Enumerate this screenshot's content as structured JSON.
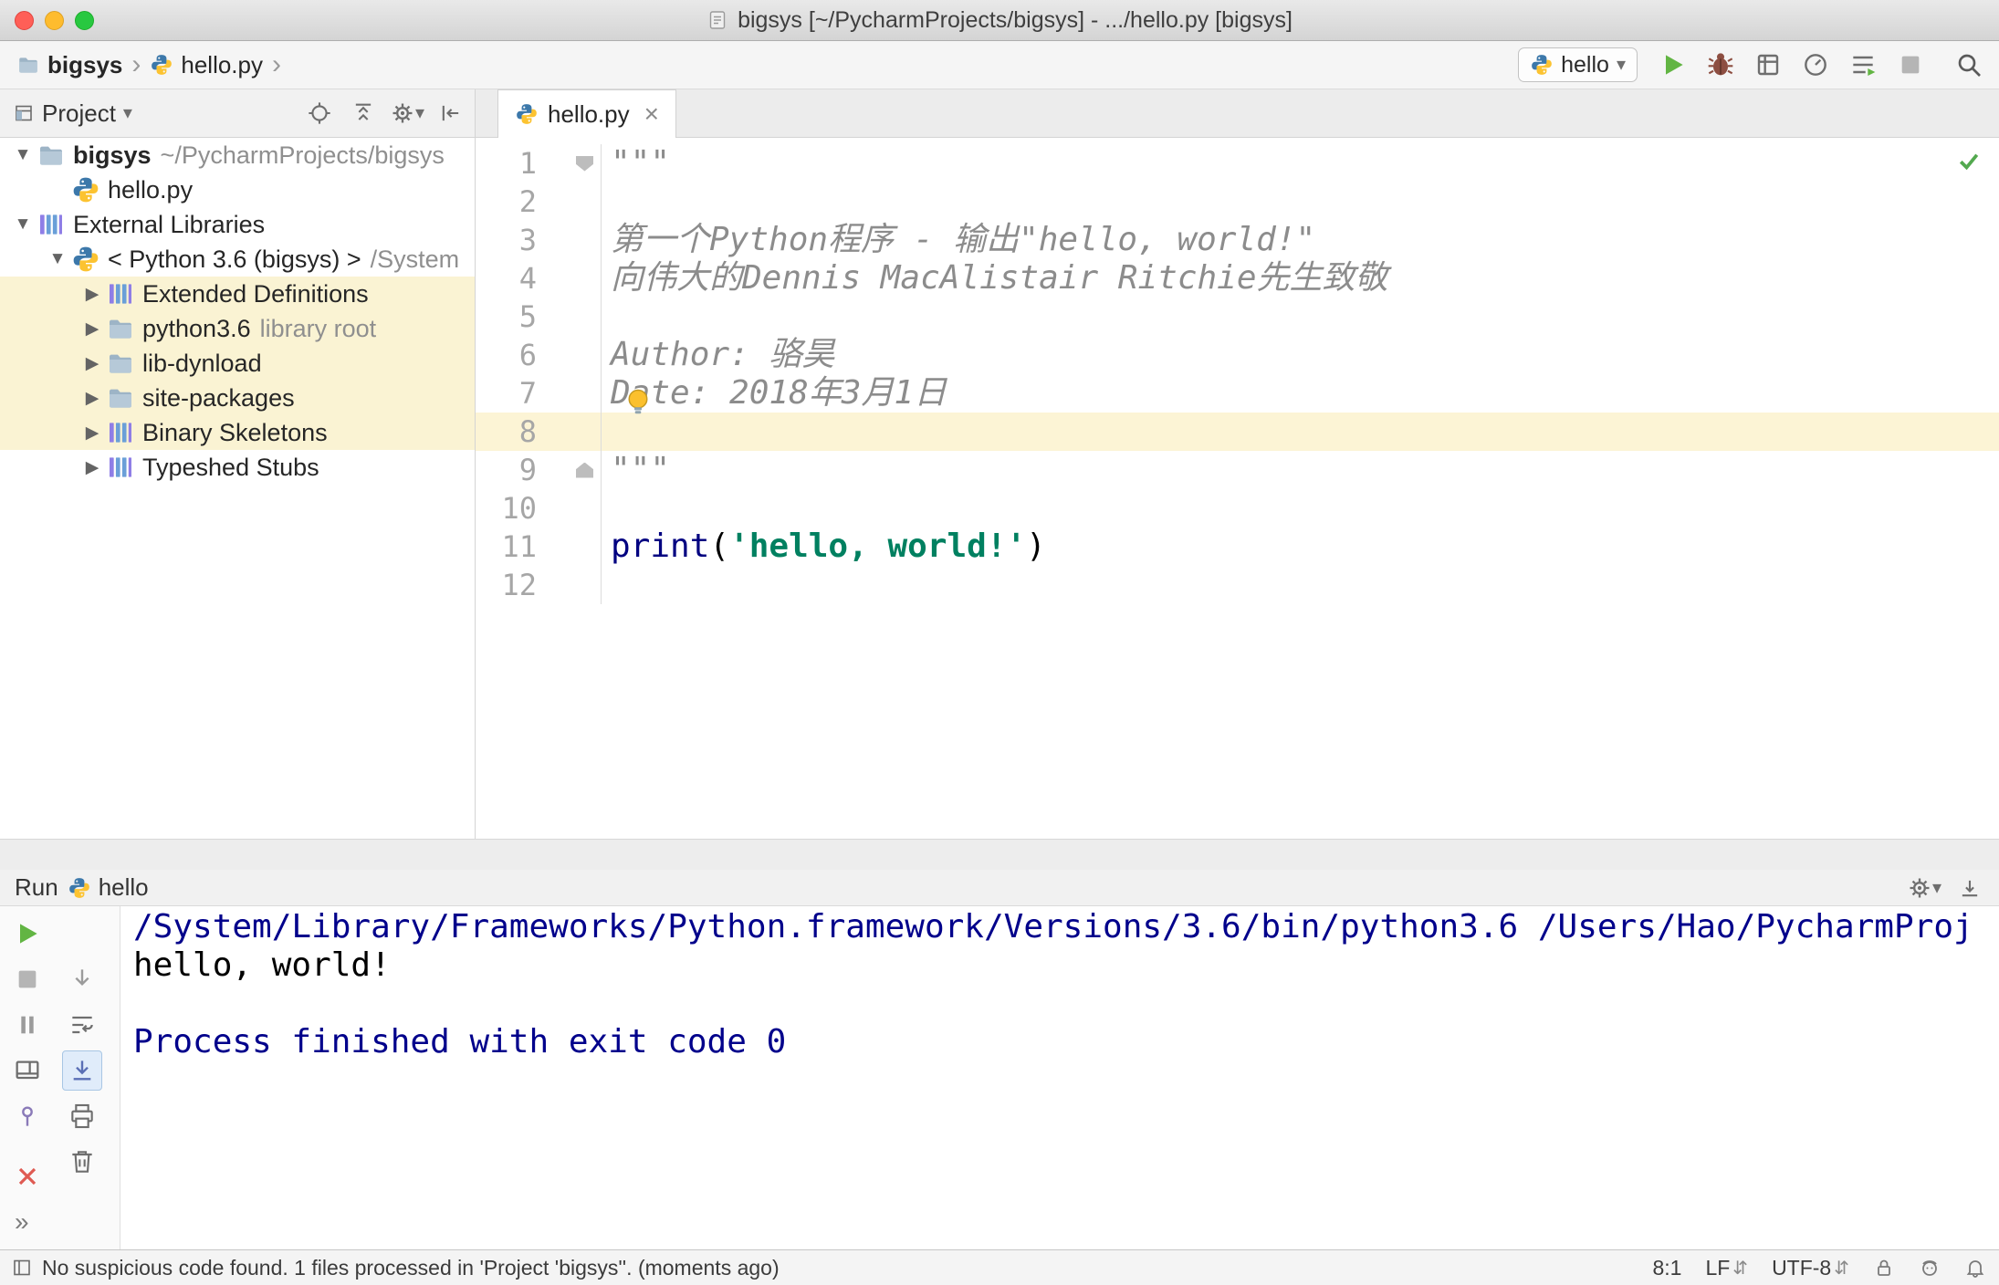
{
  "window": {
    "title": "bigsys [~/PycharmProjects/bigsys] - .../hello.py [bigsys]"
  },
  "navbar": {
    "breadcrumbs": [
      {
        "label": "bigsys",
        "icon": "folder"
      },
      {
        "label": "hello.py",
        "icon": "python"
      }
    ],
    "run_config": {
      "label": "hello"
    }
  },
  "project": {
    "header": {
      "title": "Project"
    },
    "tree": [
      {
        "level": 0,
        "chevron": "expanded",
        "icon": "folder",
        "label": "bigsys",
        "suffix": "~/PycharmProjects/bigsys",
        "bold": true
      },
      {
        "level": 1,
        "chevron": "none",
        "icon": "python",
        "label": "hello.py"
      },
      {
        "level": 0,
        "chevron": "expanded",
        "icon": "library",
        "label": "External Libraries"
      },
      {
        "level": 1,
        "chevron": "expanded",
        "icon": "python",
        "label": "< Python 3.6 (bigsys) >",
        "suffix": "/System"
      },
      {
        "level": 2,
        "chevron": "collapsed",
        "icon": "library",
        "label": "Extended Definitions",
        "highlight": true
      },
      {
        "level": 2,
        "chevron": "collapsed",
        "icon": "folder",
        "label": "python3.6",
        "suffix": "library root",
        "highlight": true
      },
      {
        "level": 2,
        "chevron": "collapsed",
        "icon": "folder",
        "label": "lib-dynload",
        "highlight": true
      },
      {
        "level": 2,
        "chevron": "collapsed",
        "icon": "folder",
        "label": "site-packages",
        "highlight": true
      },
      {
        "level": 2,
        "chevron": "collapsed",
        "icon": "library",
        "label": "Binary Skeletons",
        "highlight": true
      },
      {
        "level": 2,
        "chevron": "collapsed",
        "icon": "library",
        "label": "Typeshed Stubs",
        "highlight": false
      }
    ]
  },
  "editor": {
    "tab": {
      "label": "hello.py"
    },
    "lines": [
      {
        "num": 1,
        "fold": "start",
        "tokens": [
          {
            "text": "\"\"\"",
            "style": "docstring"
          }
        ]
      },
      {
        "num": 2,
        "tokens": []
      },
      {
        "num": 3,
        "tokens": [
          {
            "text": "第一个Python程序 - 输出\"hello, world!\"",
            "style": "docstring"
          }
        ]
      },
      {
        "num": 4,
        "tokens": [
          {
            "text": "向伟大的Dennis MacAlistair Ritchie先生致敬",
            "style": "docstring"
          }
        ]
      },
      {
        "num": 5,
        "tokens": []
      },
      {
        "num": 6,
        "tokens": [
          {
            "text": "Author: 骆昊",
            "style": "docstring"
          }
        ]
      },
      {
        "num": 7,
        "tokens": [
          {
            "text": "Date: 2018年3月1日",
            "style": "docstring"
          }
        ]
      },
      {
        "num": 8,
        "current": true,
        "tokens": []
      },
      {
        "num": 9,
        "fold": "end",
        "tokens": [
          {
            "text": "\"\"\"",
            "style": "docstring"
          }
        ]
      },
      {
        "num": 10,
        "tokens": []
      },
      {
        "num": 11,
        "tokens": [
          {
            "text": "print",
            "style": "keyword"
          },
          {
            "text": "(",
            "style": "plain"
          },
          {
            "text": "'hello, world!'",
            "style": "string"
          },
          {
            "text": ")",
            "style": "plain"
          }
        ]
      },
      {
        "num": 12,
        "tokens": []
      }
    ]
  },
  "run": {
    "title": "Run",
    "config": "hello",
    "console": [
      {
        "text": "/System/Library/Frameworks/Python.framework/Versions/3.6/bin/python3.6 /Users/Hao/PycharmProj",
        "style": "system"
      },
      {
        "text": "hello, world!",
        "style": "stdout"
      },
      {
        "text": "",
        "style": "stdout"
      },
      {
        "text": "Process finished with exit code 0",
        "style": "system"
      }
    ]
  },
  "statusbar": {
    "message": "No suspicious code found. 1 files processed in 'Project 'bigsys''. (moments ago)",
    "position": "8:1",
    "line_ending": "LF",
    "encoding": "UTF-8"
  },
  "icons": {
    "tree-expanded": "▼",
    "tree-collapsed": "▶",
    "breadcrumb-separator": "›",
    "dropdown-arrow": "▾",
    "more-chevron": "»",
    "updown-arrows": "⇵",
    "tab-close": "×"
  },
  "colors": {
    "caret_line": "#fcf4d5",
    "tree_highlight": "#faf3d3",
    "docstring": "#8c8c8c",
    "keyword": "#000080",
    "string": "#008060",
    "console_info": "#00008b",
    "run_green": "#62b543",
    "close_red": "#df5a52",
    "checkmark_green": "#53a94f"
  }
}
